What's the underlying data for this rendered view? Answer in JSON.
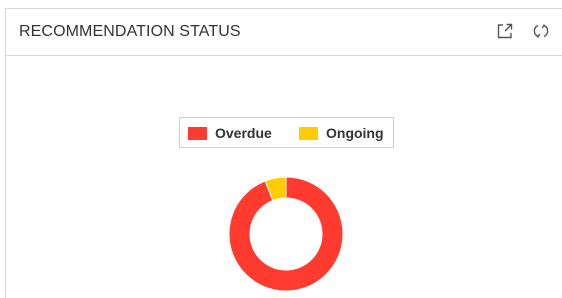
{
  "panel": {
    "title": "RECOMMENDATION STATUS",
    "actions": [
      {
        "icon": "external-link-icon"
      },
      {
        "icon": "refresh-icon"
      }
    ]
  },
  "chart_data": {
    "type": "pie",
    "donut": true,
    "legend_position": "top-center",
    "series": [
      {
        "name": "Overdue",
        "value": 94,
        "color": "#ff3b30"
      },
      {
        "name": "Ongoing",
        "value": 6,
        "color": "#ffcc00"
      }
    ]
  }
}
